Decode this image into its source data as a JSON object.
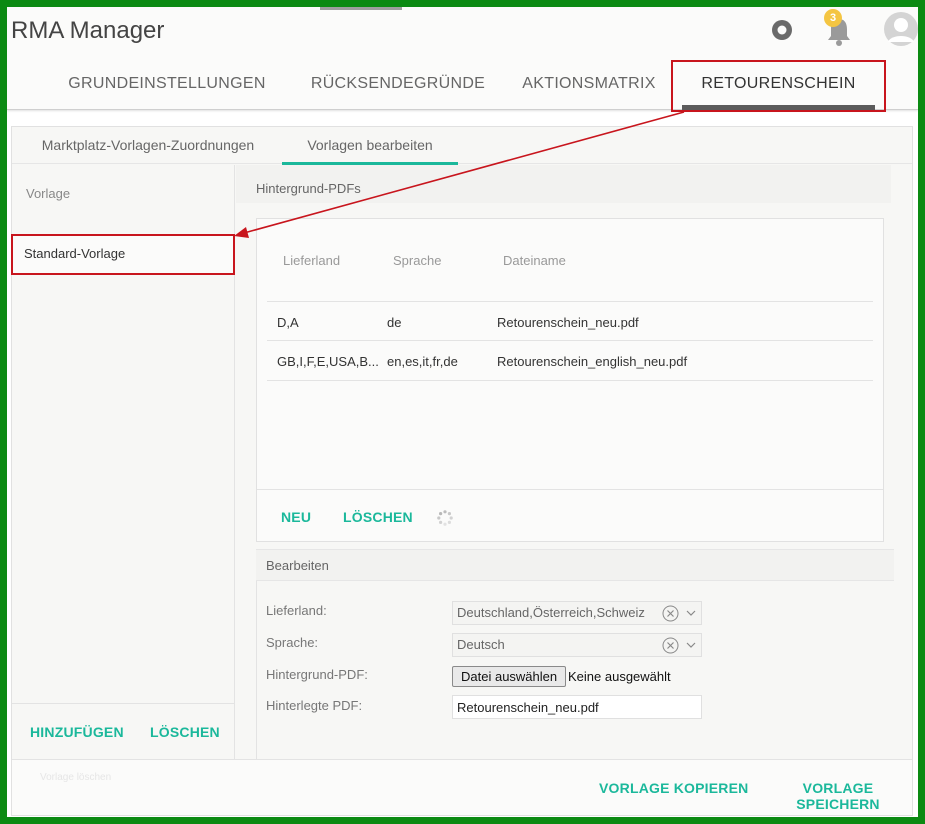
{
  "app": {
    "title": "RMA Manager",
    "notification_count": "3"
  },
  "main_tabs": [
    {
      "label": "GRUNDEINSTELLUNGEN"
    },
    {
      "label": "RÜCKSENDEGRÜNDE"
    },
    {
      "label": "AKTIONSMATRIX"
    },
    {
      "label": "RETOURENSCHEIN",
      "active": true
    }
  ],
  "sub_tabs": [
    {
      "label": "Marktplatz-Vorlagen-Zuordnungen"
    },
    {
      "label": "Vorlagen bearbeiten",
      "active": true
    }
  ],
  "left_pane": {
    "heading": "Vorlage",
    "items": [
      {
        "label": "Standard-Vorlage",
        "selected": true
      }
    ],
    "add_label": "HINZUFÜGEN",
    "delete_label": "LÖSCHEN"
  },
  "background_pdfs": {
    "title": "Hintergrund-PDFs",
    "columns": [
      "Lieferland",
      "Sprache",
      "Dateiname"
    ],
    "rows": [
      {
        "lieferland": "D,A",
        "sprache": "de",
        "dateiname": "Retourenschein_neu.pdf"
      },
      {
        "lieferland": "GB,I,F,E,USA,B...",
        "sprache": "en,es,it,fr,de",
        "dateiname": "Retourenschein_english_neu.pdf"
      }
    ],
    "new_label": "NEU",
    "delete_label": "LÖSCHEN"
  },
  "edit": {
    "title": "Bearbeiten",
    "lieferland_label": "Lieferland:",
    "lieferland_value": "Deutschland,Österreich,Schweiz",
    "sprache_label": "Sprache:",
    "sprache_value": "Deutsch",
    "hintergrund_label": "Hintergrund-PDF:",
    "file_button_label": "Datei auswählen",
    "file_status": "Keine ausgewählt",
    "hinterlegt_label": "Hinterlegte PDF:",
    "hinterlegt_value": "Retourenschein_neu.pdf"
  },
  "footer": {
    "faded_text": "Vorlage löschen",
    "copy_label": "VORLAGE KOPIEREN",
    "save_label": "VORLAGE SPEICHERN"
  },
  "colors": {
    "accent": "#1bb89b",
    "annotation_red": "#c8151d",
    "frame_green": "#0b8a12",
    "badge_yellow": "#f4c542"
  },
  "icons": [
    "settings-icon",
    "notification-bell-icon",
    "user-avatar-icon",
    "clear-icon",
    "chevron-down-icon",
    "loading-spinner-icon"
  ]
}
